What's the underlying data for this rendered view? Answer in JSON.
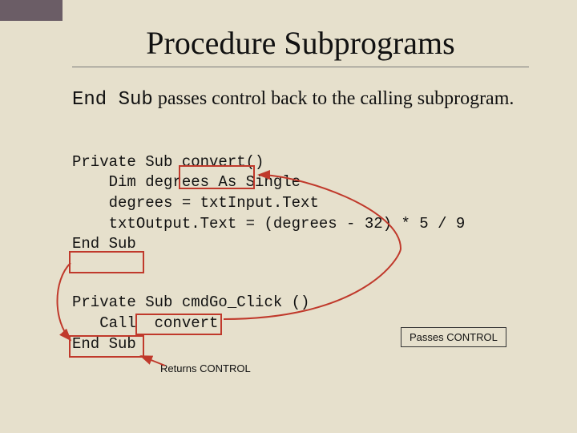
{
  "title": "Procedure Subprograms",
  "intro": {
    "code": "End Sub",
    "rest": " passes control back to the calling subprogram."
  },
  "code_block1": {
    "line1_a": "Private Sub ",
    "line1_b": "convert",
    "line1_c": "()",
    "line2": "    Dim degrees As Single",
    "line3": "    degrees = txtInput.Text",
    "line4": "    txtOutput.Text = (degrees - 32) * 5 / 9",
    "line5": "End Sub"
  },
  "code_block2": {
    "line1": "Private Sub cmdGo_Click ()",
    "line2_a": "   Call ",
    "line2_b": " convert",
    "line3": "End Sub"
  },
  "labels": {
    "passes": "Passes CONTROL",
    "returns": "Returns CONTROL"
  },
  "colors": {
    "accent": "#c0392b",
    "bg": "#e6e0cc"
  }
}
